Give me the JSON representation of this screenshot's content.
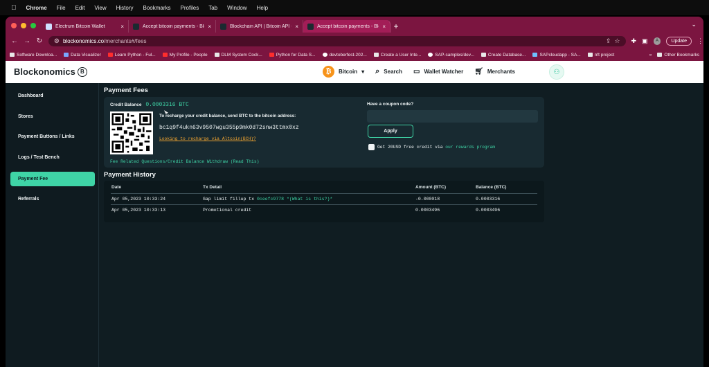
{
  "menubar": {
    "app": "Chrome",
    "items": [
      "File",
      "Edit",
      "View",
      "History",
      "Bookmarks",
      "Profiles",
      "Tab",
      "Window",
      "Help"
    ]
  },
  "browser": {
    "tabs": [
      {
        "title": "Electrum Bitcoin Wallet"
      },
      {
        "title": "Accept bitcoin payments - Blo"
      },
      {
        "title": "Blockchain API | Bitcoin API - B"
      },
      {
        "title": "Accept bitcoin payments - Blo"
      }
    ],
    "url_domain": "blockonomics.co",
    "url_path": "/merchants#/fees",
    "profile_initial": "A",
    "update_label": "Update",
    "bookmarks": [
      {
        "label": "Software Downloa..."
      },
      {
        "label": "Data Visualizer"
      },
      {
        "label": "Learn Python - Ful..."
      },
      {
        "label": "My Profile - People"
      },
      {
        "label": "DLM System Cock..."
      },
      {
        "label": "Python for Data S..."
      },
      {
        "label": "devtoberfest-202..."
      },
      {
        "label": "Create a User Inte..."
      },
      {
        "label": "SAP-samples/dev..."
      },
      {
        "label": "Create Database..."
      },
      {
        "label": "SAPcloudapp - SA..."
      },
      {
        "label": "nft project"
      }
    ],
    "bookmarks_more": "»",
    "other_bookmarks": "Other Bookmarks"
  },
  "site": {
    "logo": "Blockonomics",
    "logo_mark": "B",
    "nav": {
      "currency": "Bitcoin",
      "search": "Search",
      "wallet_watcher": "Wallet Watcher",
      "merchants": "Merchants"
    }
  },
  "sidebar": {
    "items": [
      {
        "label": "Dashboard"
      },
      {
        "label": "Stores"
      },
      {
        "label": "Payment Buttons / Links"
      },
      {
        "label": "Logs / Test Bench"
      },
      {
        "label": "Payment Fee"
      },
      {
        "label": "Referrals"
      }
    ],
    "active_index": 4
  },
  "fees": {
    "title": "Payment Fees",
    "credit_balance_label": "Credit Balance",
    "credit_balance_value": "0.0003316 BTC",
    "recharge_text": "To recharge your credit balance, send BTC to the bitcoin address:",
    "address": "bc1q9f4ukn63v9507wgu355p9mk0d72snw3ttmx0xz",
    "altcoin_link": "Looking to recharge via Altcoin(BCH)?",
    "faq_link": "Fee Related Questions/Credit Balance Withdraw (Read This)",
    "coupon_label": "Have a coupon code?",
    "apply_label": "Apply",
    "rewards_text": "Get 20USD free credit via",
    "rewards_link": "our rewards program"
  },
  "history": {
    "title": "Payment History",
    "columns": [
      "Date",
      "Tx Detail",
      "Amount (BTC)",
      "Balance (BTC)"
    ],
    "rows": [
      {
        "date": "Apr 05,2023 10:33:24",
        "detail": "Gap limit fillup tx",
        "tx": "0ceefc9778",
        "note": "*(What is this?)*",
        "amount": "-0.000018",
        "balance": "0.0003316"
      },
      {
        "date": "Apr 05,2023 10:33:13",
        "detail": "Promotional credit",
        "tx": "",
        "note": "",
        "amount": "0.0003496",
        "balance": "0.0003496"
      }
    ]
  },
  "colors": {
    "accent": "#3fd4a6",
    "tab_bar": "#7b1540",
    "page_bg": "#101d22",
    "card_bg": "#182a31",
    "link_orange": "#f0a431"
  }
}
